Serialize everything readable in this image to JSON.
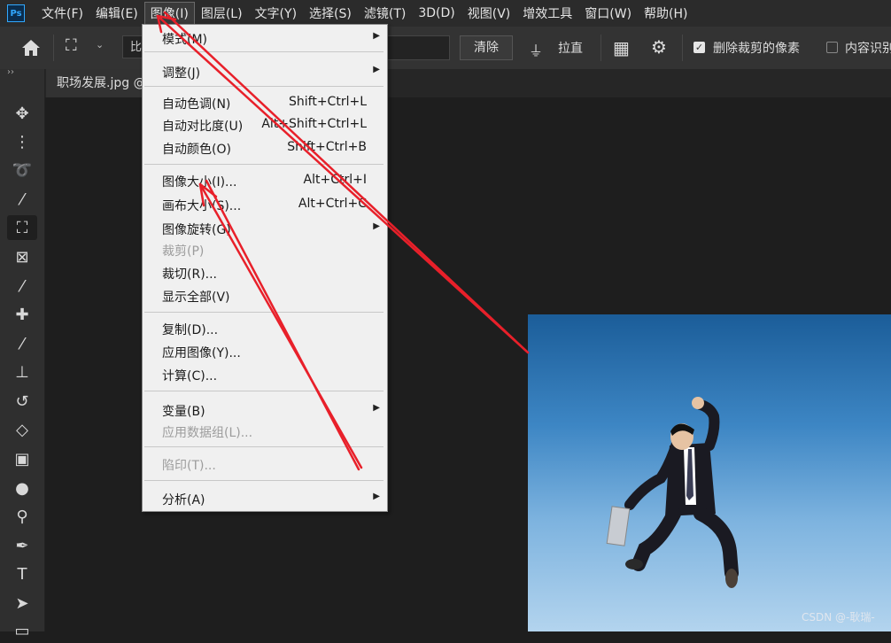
{
  "app": {
    "logo_text": "Ps"
  },
  "menubar": {
    "items": [
      "文件(F)",
      "编辑(E)",
      "图像(I)",
      "图层(L)",
      "文字(Y)",
      "选择(S)",
      "滤镜(T)",
      "3D(D)",
      "视图(V)",
      "增效工具",
      "窗口(W)",
      "帮助(H)"
    ],
    "active_index": 2
  },
  "options_bar": {
    "ratio_text": "比",
    "clear_label": "清除",
    "straighten_label": "拉直",
    "delete_cropped_label": "删除裁剪的像素",
    "delete_cropped_checked": true,
    "content_aware_label": "内容识别",
    "content_aware_checked": false
  },
  "toolbar": {
    "tools": [
      "move-tool",
      "marquee-tool",
      "lasso-tool",
      "magic-wand-tool",
      "crop-tool",
      "frame-tool",
      "eyedropper-tool",
      "healing-brush-tool",
      "brush-tool",
      "clone-stamp-tool",
      "history-brush-tool",
      "eraser-tool",
      "gradient-tool",
      "blur-tool",
      "dodge-tool",
      "pen-tool",
      "type-tool",
      "path-selection-tool",
      "rectangle-tool"
    ],
    "selected": "crop-tool"
  },
  "document": {
    "tab_label": "职场发展.jpg @"
  },
  "image_menu": {
    "items": [
      {
        "label": "模式(M)",
        "submenu": true
      },
      {
        "label": "调整(J)",
        "submenu": true
      },
      {
        "label": "自动色调(N)",
        "shortcut": "Shift+Ctrl+L"
      },
      {
        "label": "自动对比度(U)",
        "shortcut": "Alt+Shift+Ctrl+L"
      },
      {
        "label": "自动颜色(O)",
        "shortcut": "Shift+Ctrl+B"
      },
      {
        "label": "图像大小(I)...",
        "shortcut": "Alt+Ctrl+I"
      },
      {
        "label": "画布大小(S)...",
        "shortcut": "Alt+Ctrl+C"
      },
      {
        "label": "图像旋转(G)",
        "submenu": true
      },
      {
        "label": "裁剪(P)",
        "disabled": true
      },
      {
        "label": "裁切(R)..."
      },
      {
        "label": "显示全部(V)"
      },
      {
        "label": "复制(D)..."
      },
      {
        "label": "应用图像(Y)..."
      },
      {
        "label": "计算(C)..."
      },
      {
        "label": "变量(B)",
        "submenu": true
      },
      {
        "label": "应用数据组(L)...",
        "disabled": true
      },
      {
        "label": "陷印(T)...",
        "disabled": true
      },
      {
        "label": "分析(A)",
        "submenu": true
      }
    ]
  },
  "watermark": "CSDN @-耿瑞-",
  "colors": {
    "annotation_arrow": "#e8202a",
    "menu_bg": "#f0f0f0",
    "app_bg": "#1e1e1e"
  }
}
